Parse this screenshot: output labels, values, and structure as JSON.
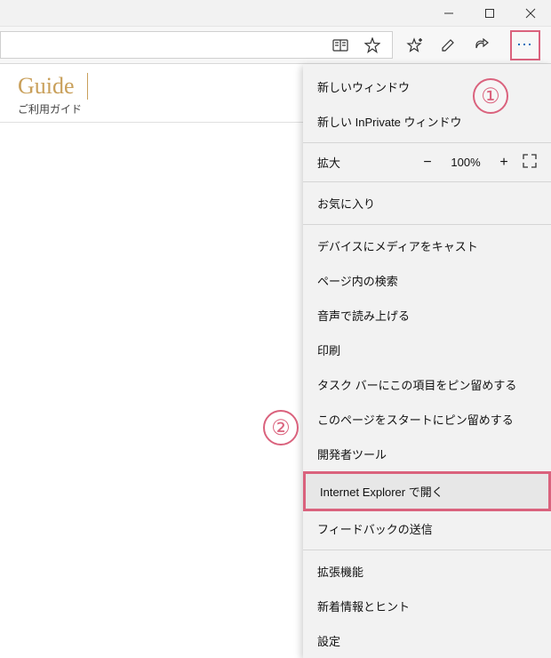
{
  "window": {
    "minimize": "—",
    "maximize": "❐",
    "close": "×"
  },
  "toolbar": {
    "reading_icon": "reading-view",
    "star_icon": "favorite-star",
    "add_fav_icon": "add-favorite",
    "notes_icon": "web-notes",
    "share_icon": "share",
    "more": "⋯"
  },
  "page": {
    "guide_title": "Guide",
    "guide_sub": "ご利用ガイド"
  },
  "menu": {
    "new_window": "新しいウィンドウ",
    "new_inprivate": "新しい InPrivate ウィンドウ",
    "zoom_label": "拡大",
    "zoom_minus": "−",
    "zoom_value": "100%",
    "zoom_plus": "+",
    "favorites": "お気に入り",
    "cast": "デバイスにメディアをキャスト",
    "find": "ページ内の検索",
    "read_aloud": "音声で読み上げる",
    "print": "印刷",
    "pin_taskbar": "タスク バーにこの項目をピン留めする",
    "pin_start": "このページをスタートにピン留めする",
    "dev_tools": "開発者ツール",
    "open_ie": "Internet Explorer で開く",
    "feedback": "フィードバックの送信",
    "extensions": "拡張機能",
    "whats_new": "新着情報とヒント",
    "settings": "設定"
  },
  "annotations": {
    "one": "①",
    "two": "②"
  }
}
